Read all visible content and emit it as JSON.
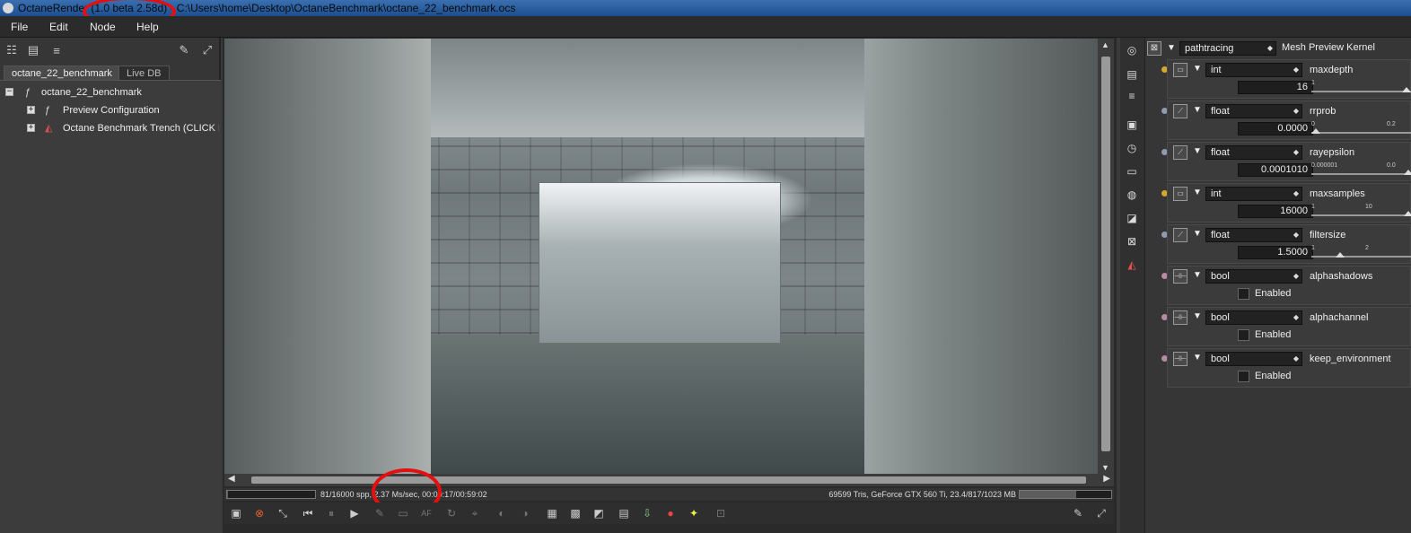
{
  "title_bar": {
    "app": "OctaneRender",
    "version": "(1.0 beta 2.58d)",
    "separator": " - ",
    "path": "C:\\Users\\home\\Desktop\\OctaneBenchmark\\octane_22_benchmark.ocs"
  },
  "menu": [
    "File",
    "Edit",
    "Node",
    "Help"
  ],
  "left_panel": {
    "tabs": [
      {
        "label": "octane_22_benchmark",
        "active": true
      },
      {
        "label": "Live DB",
        "active": false
      }
    ],
    "tree": [
      {
        "label": "octane_22_benchmark",
        "expander": "−"
      },
      {
        "label": "Preview Configuration",
        "expander": "+"
      },
      {
        "label": "Octane Benchmark Trench (CLICK MI",
        "expander": "+"
      }
    ]
  },
  "status": {
    "left_text": "81/16000 spp, 2.37 Ms/sec, 00:00:17/00:59:02",
    "right_text": "69599 Tris, GeForce GTX 560 Ti, 23.4/817/1023 MB",
    "render_progress": 0.005,
    "memory_progress": 0.62
  },
  "toolbar": {
    "af_label": "AF"
  },
  "kernel": {
    "type": "pathtracing",
    "label": "Mesh Preview Kernel"
  },
  "params": [
    {
      "type": "int",
      "name": "maxdepth",
      "value": "16",
      "kind": "slider",
      "tick_min": "1",
      "tick_max": "",
      "knob": 0.95,
      "dot_color": "#d4a82a",
      "icon": "int"
    },
    {
      "type": "float",
      "name": "rrprob",
      "value": "0.0000",
      "kind": "slider",
      "tick_min": "0",
      "tick_max": "0.2",
      "knob": 0.0,
      "dot_color": "#8e9bb3",
      "icon": "float"
    },
    {
      "type": "float",
      "name": "rayepsilon",
      "value": "0.0001010",
      "kind": "slider",
      "tick_min": "0.000001",
      "tick_max": "0.0",
      "knob": 0.97,
      "dot_color": "#8e9bb3",
      "icon": "float"
    },
    {
      "type": "int",
      "name": "maxsamples",
      "value": "16000",
      "kind": "slider",
      "tick_min": "1",
      "tick_max": "10",
      "knob": 0.97,
      "dot_color": "#d4a82a",
      "icon": "int"
    },
    {
      "type": "float",
      "name": "filtersize",
      "value": "1.5000",
      "kind": "slider",
      "tick_min": "1",
      "tick_max": "2",
      "knob": 0.25,
      "dot_color": "#8e9bb3",
      "icon": "float"
    },
    {
      "type": "bool",
      "name": "alphashadows",
      "value": "Enabled",
      "kind": "checkbox",
      "dot_color": "#b98aa6",
      "icon": "bool"
    },
    {
      "type": "bool",
      "name": "alphachannel",
      "value": "Enabled",
      "kind": "checkbox",
      "dot_color": "#b98aa6",
      "icon": "bool"
    },
    {
      "type": "bool",
      "name": "keep_environment",
      "value": "Enabled",
      "kind": "checkbox",
      "dot_color": "#b98aa6",
      "icon": "bool"
    }
  ],
  "colors": {
    "title_bar": "#2a5fa3",
    "annotation_circle": "#e41010",
    "panel_bg": "#363636"
  }
}
